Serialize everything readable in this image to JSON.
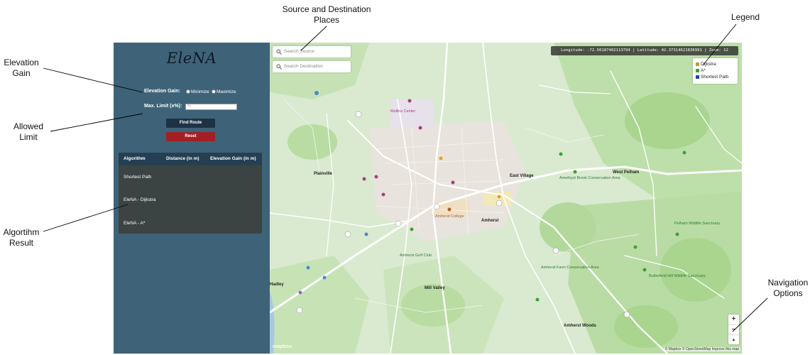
{
  "annotations": {
    "source_destination": "Source and Destination\nPlaces",
    "legend": "Legend",
    "elevation_gain": "Elevation\nGain",
    "allowed_limit": "Allowed\nLimit",
    "algorithm_result": "Algortihm\nResult",
    "navigation_options": "Navigation\nOptions"
  },
  "panel": {
    "app_title": "EleNA",
    "elevation_gain_label": "Elevation Gain:",
    "minimize_label": "Minimize",
    "maximize_label": "Maximize",
    "max_limit_label": "Max. Limit (x%):",
    "max_limit_placeholder": "%",
    "find_route_label": "Find Route",
    "reset_label": "Reset",
    "table": {
      "headers": [
        "Algorithm",
        "Distance (in m)",
        "Elevation Gain (in m)"
      ],
      "rows": [
        "Shortest Path",
        "EleNA - Dijkstra",
        "EleNA - A*"
      ]
    }
  },
  "map": {
    "search_source_placeholder": "Search Source",
    "search_destination_placeholder": "Search Destination",
    "coords_readout": "Longitude: -72.50187402113794 | Latitude: 42.37314621836991 | Zoom: 12",
    "legend": {
      "items": [
        {
          "label": "Dijkstra",
          "color": "#b5a12f"
        },
        {
          "label": "A*",
          "color": "#3fa13a"
        },
        {
          "label": "Shortest Path",
          "color": "#2c3fa7"
        }
      ]
    },
    "zoom_in": "+",
    "zoom_out": "−",
    "compass": "▲",
    "logo": "mapbox",
    "attribution": "© Mapbox © OpenStreetMap Improve this map",
    "places": [
      "Amherst",
      "Plainville",
      "East Village",
      "West Pelham",
      "Mill Valley",
      "Hadley",
      "Amherst Woods",
      "Amherst College",
      "Amherst Golf Club",
      "Mullins Center",
      "Amherst Farm Conservation Area",
      "Amethyst Brook Conservation Area",
      "Pelham Wildlife Sanctuary",
      "Butterfield Hill Wildlife Sanctuary"
    ]
  },
  "colors": {
    "panel_bg": "#3e6378",
    "find_route_bg": "#1d3345",
    "reset_bg": "#a41f24",
    "table_header_bg": "#253f52",
    "table_body_bg": "#3b4443"
  }
}
